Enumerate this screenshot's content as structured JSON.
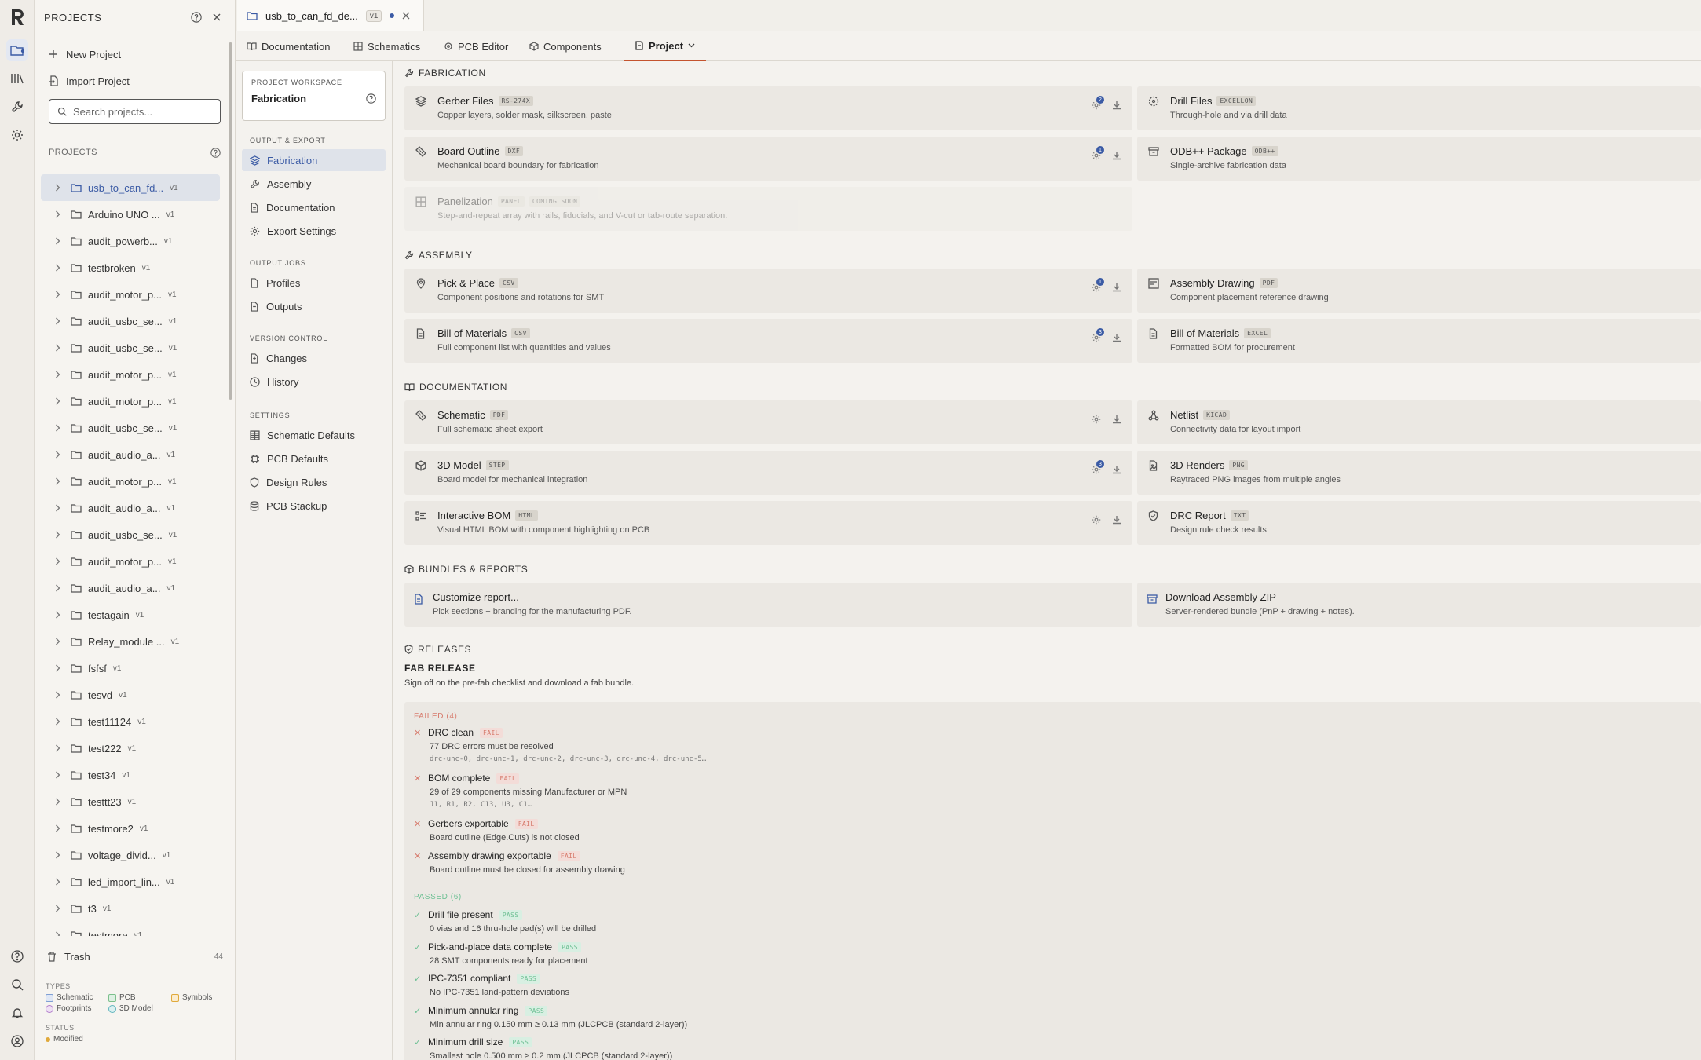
{
  "colors": {
    "accent": "#3b5ba5",
    "active_tab": "#c4542e",
    "fail": "#d77a6c",
    "pass": "#6ec094"
  },
  "rail": {
    "icons": [
      "logo-icon",
      "projects-icon",
      "library-icon",
      "tools-icon",
      "settings-icon",
      "help-icon",
      "search-icon",
      "bell-icon",
      "account-icon"
    ]
  },
  "projects_panel": {
    "title": "PROJECTS",
    "new_project": "New Project",
    "import_project": "Import Project",
    "search_placeholder": "Search projects...",
    "list_label": "PROJECTS",
    "items": [
      {
        "name": "usb_to_can_fd...",
        "ver": "v1"
      },
      {
        "name": "Arduino UNO ...",
        "ver": "v1"
      },
      {
        "name": "audit_powerb...",
        "ver": "v1"
      },
      {
        "name": "testbroken",
        "ver": "v1"
      },
      {
        "name": "audit_motor_p...",
        "ver": "v1"
      },
      {
        "name": "audit_usbc_se...",
        "ver": "v1"
      },
      {
        "name": "audit_usbc_se...",
        "ver": "v1"
      },
      {
        "name": "audit_motor_p...",
        "ver": "v1"
      },
      {
        "name": "audit_motor_p...",
        "ver": "v1"
      },
      {
        "name": "audit_usbc_se...",
        "ver": "v1"
      },
      {
        "name": "audit_audio_a...",
        "ver": "v1"
      },
      {
        "name": "audit_motor_p...",
        "ver": "v1"
      },
      {
        "name": "audit_audio_a...",
        "ver": "v1"
      },
      {
        "name": "audit_usbc_se...",
        "ver": "v1"
      },
      {
        "name": "audit_motor_p...",
        "ver": "v1"
      },
      {
        "name": "audit_audio_a...",
        "ver": "v1"
      },
      {
        "name": "testagain",
        "ver": "v1"
      },
      {
        "name": "Relay_module ...",
        "ver": "v1"
      },
      {
        "name": "fsfsf",
        "ver": "v1"
      },
      {
        "name": "tesvd",
        "ver": "v1"
      },
      {
        "name": "test11124",
        "ver": "v1"
      },
      {
        "name": "test222",
        "ver": "v1"
      },
      {
        "name": "test34",
        "ver": "v1"
      },
      {
        "name": "testtt23",
        "ver": "v1"
      },
      {
        "name": "testmore2",
        "ver": "v1"
      },
      {
        "name": "voltage_divid...",
        "ver": "v1"
      },
      {
        "name": "led_import_lin...",
        "ver": "v1"
      },
      {
        "name": "t3",
        "ver": "v1"
      },
      {
        "name": "testmore",
        "ver": "v1"
      }
    ],
    "trash_label": "Trash",
    "trash_count": "44",
    "types_label": "TYPES",
    "types": [
      "Schematic",
      "PCB",
      "Symbols",
      "Footprints",
      "3D Model"
    ],
    "status_label": "STATUS",
    "status_modified": "Modified"
  },
  "file_tab": {
    "name": "usb_to_can_fd_de...",
    "version": "v1"
  },
  "nav_tabs": [
    "Documentation",
    "Schematics",
    "PCB Editor",
    "Components",
    "Project"
  ],
  "workspace": {
    "kicker": "PROJECT WORKSPACE",
    "current": "Fabrication",
    "sections": [
      {
        "label": "OUTPUT & EXPORT",
        "items": [
          "Fabrication",
          "Assembly",
          "Documentation",
          "Export Settings"
        ]
      },
      {
        "label": "OUTPUT JOBS",
        "items": [
          "Profiles",
          "Outputs"
        ]
      },
      {
        "label": "VERSION CONTROL",
        "items": [
          "Changes",
          "History"
        ]
      },
      {
        "label": "SETTINGS",
        "items": [
          "Schematic Defaults",
          "PCB Defaults",
          "Design Rules",
          "PCB Stackup"
        ]
      }
    ]
  },
  "main": {
    "fabrication": {
      "heading": "FABRICATION",
      "cards": [
        {
          "title": "Gerber Files",
          "badge": "RS-274X",
          "desc": "Copper layers, solder mask, silkscreen, paste",
          "count": "2"
        },
        {
          "title": "Drill Files",
          "badge": "EXCELLON",
          "desc": "Through-hole and via drill data"
        },
        {
          "title": "Board Outline",
          "badge": "DXF",
          "desc": "Mechanical board boundary for fabrication",
          "count": "1"
        },
        {
          "title": "ODB++ Package",
          "badge": "ODB++",
          "desc": "Single-archive fabrication data"
        },
        {
          "title": "Panelization",
          "badge": "PANEL",
          "badge2": "COMING SOON",
          "desc": "Step-and-repeat array with rails, fiducials, and V-cut or tab-route separation."
        }
      ]
    },
    "assembly": {
      "heading": "ASSEMBLY",
      "cards": [
        {
          "title": "Pick & Place",
          "badge": "CSV",
          "desc": "Component positions and rotations for SMT",
          "count": "1"
        },
        {
          "title": "Assembly Drawing",
          "badge": "PDF",
          "desc": "Component placement reference drawing"
        },
        {
          "title": "Bill of Materials",
          "badge": "CSV",
          "desc": "Full component list with quantities and values",
          "count": "3"
        },
        {
          "title": "Bill of Materials",
          "badge": "EXCEL",
          "desc": "Formatted BOM for procurement"
        }
      ]
    },
    "documentation": {
      "heading": "DOCUMENTATION",
      "cards": [
        {
          "title": "Schematic",
          "badge": "PDF",
          "desc": "Full schematic sheet export"
        },
        {
          "title": "Netlist",
          "badge": "KICAD",
          "desc": "Connectivity data for layout import"
        },
        {
          "title": "3D Model",
          "badge": "STEP",
          "desc": "Board model for mechanical integration",
          "count": "3"
        },
        {
          "title": "3D Renders",
          "badge": "PNG",
          "desc": "Raytraced PNG images from multiple angles"
        },
        {
          "title": "Interactive BOM",
          "badge": "HTML",
          "desc": "Visual HTML BOM with component highlighting on PCB"
        },
        {
          "title": "DRC Report",
          "badge": "TXT",
          "desc": "Design rule check results"
        }
      ]
    },
    "bundles": {
      "heading": "BUNDLES & REPORTS",
      "cards": [
        {
          "title": "Customize report...",
          "desc": "Pick sections + branding for the manufacturing PDF."
        },
        {
          "title": "Download Assembly ZIP",
          "desc": "Server-rendered bundle (PnP + drawing + notes)."
        }
      ]
    },
    "releases": {
      "heading": "RELEASES",
      "title": "FAB RELEASE",
      "subtitle": "Sign off on the pre-fab checklist and download a fab bundle.",
      "failed_label": "FAILED (4)",
      "failed": [
        {
          "name": "DRC clean",
          "badge": "FAIL",
          "msg": "77 DRC errors must be resolved",
          "detail": "drc-unc-0, drc-unc-1, drc-unc-2, drc-unc-3, drc-unc-4, drc-unc-5…"
        },
        {
          "name": "BOM complete",
          "badge": "FAIL",
          "msg": "29 of 29 components missing Manufacturer or MPN",
          "detail": "J1, R1, R2, C13, U3, C1…"
        },
        {
          "name": "Gerbers exportable",
          "badge": "FAIL",
          "msg": "Board outline (Edge.Cuts) is not closed"
        },
        {
          "name": "Assembly drawing exportable",
          "badge": "FAIL",
          "msg": "Board outline must be closed for assembly drawing"
        }
      ],
      "passed_label": "PASSED (6)",
      "passed": [
        {
          "name": "Drill file present",
          "badge": "PASS",
          "msg": "0 vias and 16 thru-hole pad(s) will be drilled"
        },
        {
          "name": "Pick-and-place data complete",
          "badge": "PASS",
          "msg": "28 SMT components ready for placement"
        },
        {
          "name": "IPC-7351 compliant",
          "badge": "PASS",
          "msg": "No IPC-7351 land-pattern deviations"
        },
        {
          "name": "Minimum annular ring",
          "badge": "PASS",
          "msg": "Min annular ring 0.150 mm ≥ 0.13 mm (JLCPCB (standard 2-layer))"
        },
        {
          "name": "Minimum drill size",
          "badge": "PASS",
          "msg": "Smallest hole 0.500 mm ≥ 0.2 mm (JLCPCB (standard 2-layer))"
        }
      ]
    }
  }
}
